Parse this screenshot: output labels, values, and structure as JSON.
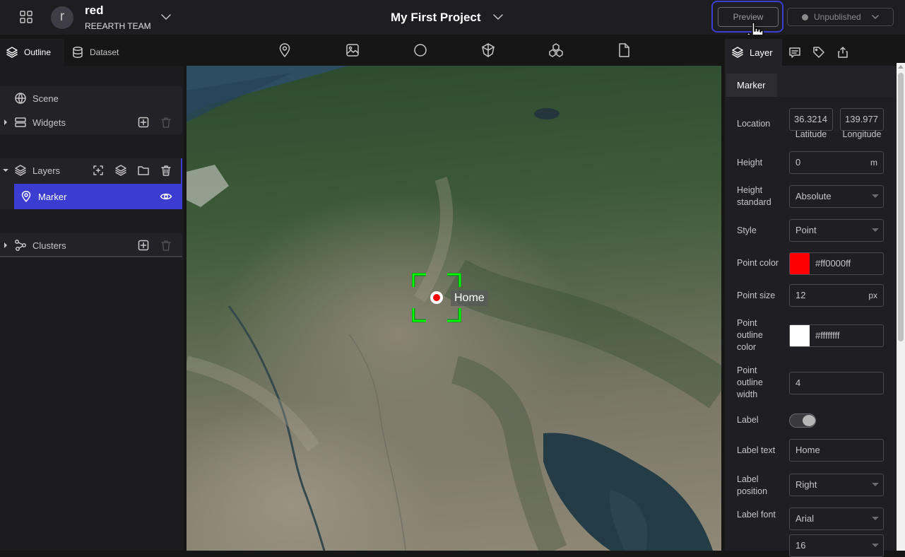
{
  "header": {
    "avatar_initial": "r",
    "user_name": "red",
    "team_name": "REEARTH TEAM",
    "project_title": "My First Project",
    "preview_label": "Preview",
    "publish_status": "Unpublished"
  },
  "left_panel": {
    "tabs": [
      {
        "label": "Outline",
        "icon": "layers-icon"
      },
      {
        "label": "Dataset",
        "icon": "database-icon"
      }
    ],
    "scene_label": "Scene",
    "widgets_label": "Widgets",
    "layers_label": "Layers",
    "marker_label": "Marker",
    "clusters_label": "Clusters"
  },
  "toolbar": {
    "tools": [
      "marker-icon",
      "image-icon",
      "circle-icon",
      "polygon-icon",
      "model-icon",
      "file-icon"
    ]
  },
  "map": {
    "marker_label": "Home",
    "marker_color": "#ff0000",
    "selection_color": "#00ff00"
  },
  "right_panel": {
    "tabs": [
      {
        "label": "Layer",
        "icon": "layers-icon"
      },
      {
        "label": "",
        "icon": "infobox-icon"
      },
      {
        "label": "",
        "icon": "tag-icon"
      },
      {
        "label": "",
        "icon": "export-icon"
      }
    ],
    "section_title": "Marker",
    "location": {
      "label": "Location",
      "latitude": "36.3214",
      "longitude": "139.977",
      "lat_label": "Latitude",
      "lng_label": "Longitude"
    },
    "height": {
      "label": "Height",
      "value": "0",
      "unit": "m"
    },
    "height_standard": {
      "label": "Height standard",
      "value": "Absolute"
    },
    "style": {
      "label": "Style",
      "value": "Point"
    },
    "point_color": {
      "label": "Point color",
      "value": "#ff0000ff",
      "swatch": "#ff0000"
    },
    "point_size": {
      "label": "Point size",
      "value": "12",
      "unit": "px"
    },
    "point_outline_color": {
      "label": "Point outline color",
      "value": "#ffffffff",
      "swatch": "#ffffff"
    },
    "point_outline_width": {
      "label": "Point outline width",
      "value": "4"
    },
    "label": {
      "label": "Label",
      "enabled": true
    },
    "label_text": {
      "label": "Label text",
      "value": "Home"
    },
    "label_position": {
      "label": "Label position",
      "value": "Right"
    },
    "label_font": {
      "label": "Label font",
      "value": "Arial",
      "size": "16"
    }
  },
  "colors": {
    "accent": "#3b3cd0",
    "selected_row": "#3b3cd0",
    "marker": "#ff0000"
  }
}
